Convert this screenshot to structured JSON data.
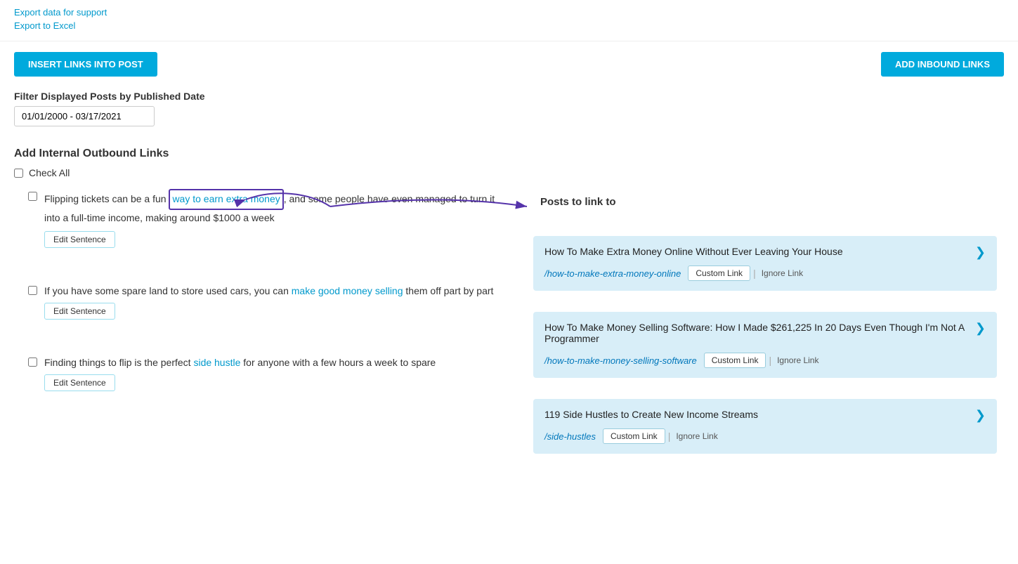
{
  "export": {
    "export_support_label": "Export data for support",
    "export_excel_label": "Export to Excel"
  },
  "buttons": {
    "insert_links": "INSERT LINKS INTO POST",
    "add_inbound": "ADD INBOUND LINKS"
  },
  "filter": {
    "label": "Filter Displayed Posts by Published Date",
    "date_value": "01/01/2000 - 03/17/2021"
  },
  "outbound": {
    "title": "Add Internal Outbound Links",
    "check_all_label": "Check All"
  },
  "posts_header": "Posts to link to",
  "sentences": [
    {
      "id": 1,
      "text_before": "Flipping tickets can be a fun ",
      "link_text": "way to earn extra money",
      "text_after": ", and some people have even managed to turn it into a full-time income, making around $1000 a week",
      "edit_label": "Edit Sentence",
      "annotated": true,
      "suggestion": {
        "title": "How To Make Extra Money Online Without Ever Leaving Your House",
        "url": "/how-to-make-extra-money-online",
        "custom_link_label": "Custom Link",
        "ignore_label": "Ignore Link"
      }
    },
    {
      "id": 2,
      "text_before": "If you have some spare land to store used cars, you can ",
      "link_text": "make good money selling",
      "text_after": " them off part by part",
      "edit_label": "Edit Sentence",
      "annotated": false,
      "suggestion": {
        "title": "How To Make Money Selling Software: How I Made $261,225 In 20 Days Even Though I'm Not A Programmer",
        "url": "/how-to-make-money-selling-software",
        "custom_link_label": "Custom Link",
        "ignore_label": "Ignore Link"
      }
    },
    {
      "id": 3,
      "text_before": "Finding things to flip is the perfect ",
      "link_text": "side hustle",
      "text_after": " for anyone with a few hours a week to spare",
      "edit_label": "Edit Sentence",
      "annotated": false,
      "suggestion": {
        "title": "119 Side Hustles to Create New Income Streams",
        "url": "/side-hustles",
        "custom_link_label": "Custom Link",
        "ignore_label": "Ignore Link"
      }
    }
  ]
}
